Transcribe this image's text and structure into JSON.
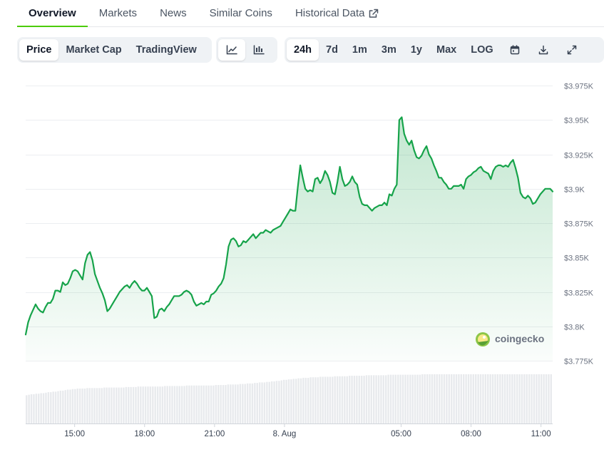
{
  "tabs": [
    {
      "label": "Overview",
      "active": true
    },
    {
      "label": "Markets"
    },
    {
      "label": "News"
    },
    {
      "label": "Similar Coins"
    },
    {
      "label": "Historical Data",
      "external": true
    }
  ],
  "chart_modes": [
    {
      "label": "Price",
      "active": true
    },
    {
      "label": "Market Cap"
    },
    {
      "label": "TradingView"
    }
  ],
  "chart_styles": [
    {
      "icon": "line-chart-icon",
      "active": true
    },
    {
      "icon": "candlestick-icon"
    }
  ],
  "ranges": [
    {
      "label": "24h",
      "active": true
    },
    {
      "label": "7d"
    },
    {
      "label": "1m"
    },
    {
      "label": "3m"
    },
    {
      "label": "1y"
    },
    {
      "label": "Max"
    },
    {
      "label": "LOG"
    }
  ],
  "tools": [
    {
      "icon": "calendar-icon"
    },
    {
      "icon": "download-icon"
    },
    {
      "icon": "fullscreen-icon"
    }
  ],
  "watermark": "coingecko",
  "colors": {
    "line": "#16a34a",
    "accent": "#4bcc00",
    "volume": "#e8eaed",
    "grid": "#eceef1"
  },
  "chart_data": {
    "type": "area",
    "x_labels": [
      "15:00",
      "18:00",
      "21:00",
      "8. Aug",
      "05:00",
      "08:00",
      "11:00"
    ],
    "x_label_hours": [
      15,
      18,
      21,
      24,
      29,
      32,
      35
    ],
    "x_start_hour": 12.9,
    "x_end_hour": 35.5,
    "y_ticks": [
      3775,
      3800,
      3825,
      3850,
      3875,
      3900,
      3925,
      3950,
      3975
    ],
    "y_tick_labels": [
      "$3.775K",
      "$3.8K",
      "$3.825K",
      "$3.85K",
      "$3.875K",
      "$3.9K",
      "$3.925K",
      "$3.95K",
      "$3.975K"
    ],
    "ylim": [
      3775,
      3975
    ],
    "grid": true,
    "series": [
      {
        "values": [
          3794,
          3803,
          3808,
          3812,
          3816,
          3813,
          3811,
          3810,
          3814,
          3817,
          3817,
          3820,
          3826,
          3826,
          3825,
          3832,
          3830,
          3831,
          3835,
          3840,
          3841,
          3840,
          3837,
          3834,
          3846,
          3852,
          3854,
          3848,
          3838,
          3833,
          3828,
          3824,
          3819,
          3811,
          3813,
          3816,
          3819,
          3822,
          3825,
          3827,
          3829,
          3830,
          3828,
          3831,
          3833,
          3831,
          3828,
          3826,
          3826,
          3828,
          3825,
          3822,
          3806,
          3807,
          3812,
          3813,
          3811,
          3814,
          3816,
          3819,
          3822,
          3822,
          3822,
          3823,
          3825,
          3826,
          3825,
          3823,
          3818,
          3815,
          3816,
          3817,
          3816,
          3818,
          3818,
          3823,
          3824,
          3826,
          3829,
          3831,
          3835,
          3845,
          3858,
          3863,
          3864,
          3862,
          3858,
          3859,
          3862,
          3861,
          3863,
          3865,
          3867,
          3864,
          3866,
          3868,
          3868,
          3870,
          3869,
          3868,
          3870,
          3871,
          3872,
          3873,
          3876,
          3879,
          3882,
          3885,
          3884,
          3884,
          3901,
          3917,
          3908,
          3900,
          3898,
          3899,
          3898,
          3907,
          3908,
          3904,
          3907,
          3913,
          3910,
          3905,
          3897,
          3896,
          3905,
          3916,
          3907,
          3902,
          3903,
          3905,
          3909,
          3905,
          3903,
          3894,
          3889,
          3888,
          3888,
          3886,
          3884,
          3886,
          3887,
          3888,
          3888,
          3890,
          3888,
          3896,
          3895,
          3900,
          3903,
          3950,
          3952,
          3940,
          3935,
          3932,
          3935,
          3928,
          3923,
          3922,
          3924,
          3928,
          3931,
          3925,
          3922,
          3917,
          3913,
          3908,
          3908,
          3905,
          3903,
          3900,
          3900,
          3902,
          3902,
          3902,
          3903,
          3900,
          3907,
          3909,
          3910,
          3912,
          3913,
          3915,
          3916,
          3913,
          3912,
          3911,
          3907,
          3913,
          3916,
          3917,
          3917,
          3916,
          3917,
          3916,
          3919,
          3921,
          3915,
          3908,
          3897,
          3894,
          3893,
          3895,
          3893,
          3889,
          3890,
          3893,
          3896,
          3898,
          3900,
          3900,
          3900,
          3898
        ]
      }
    ],
    "volume_relative": [
      0.55,
      0.56,
      0.57,
      0.57,
      0.58,
      0.58,
      0.59,
      0.59,
      0.6,
      0.61,
      0.61,
      0.62,
      0.62,
      0.63,
      0.64,
      0.64,
      0.65,
      0.66,
      0.66,
      0.67,
      0.67,
      0.68,
      0.68,
      0.68,
      0.68,
      0.69,
      0.69,
      0.69,
      0.69,
      0.69,
      0.69,
      0.69,
      0.7,
      0.7,
      0.7,
      0.7,
      0.7,
      0.7,
      0.7,
      0.7,
      0.7,
      0.71,
      0.71,
      0.71,
      0.71,
      0.71,
      0.72,
      0.72,
      0.72,
      0.72,
      0.72,
      0.72,
      0.72,
      0.72,
      0.72,
      0.72,
      0.72,
      0.73,
      0.73,
      0.73,
      0.73,
      0.73,
      0.73,
      0.73,
      0.73,
      0.73,
      0.74,
      0.74,
      0.74,
      0.74,
      0.74,
      0.74,
      0.74,
      0.74,
      0.74,
      0.74,
      0.74,
      0.74,
      0.75,
      0.75,
      0.75,
      0.75,
      0.75,
      0.76,
      0.76,
      0.76,
      0.76,
      0.76,
      0.77,
      0.77,
      0.77,
      0.78,
      0.78,
      0.78,
      0.79,
      0.79,
      0.8,
      0.8,
      0.8,
      0.81,
      0.81,
      0.82,
      0.82,
      0.83,
      0.83,
      0.84,
      0.85,
      0.85,
      0.86,
      0.86,
      0.87,
      0.87,
      0.88,
      0.88,
      0.89,
      0.89,
      0.89,
      0.9,
      0.9,
      0.9,
      0.9,
      0.91,
      0.91,
      0.91,
      0.91,
      0.91,
      0.91,
      0.92,
      0.92,
      0.92,
      0.92,
      0.92,
      0.92,
      0.93,
      0.93,
      0.93,
      0.93,
      0.93,
      0.93,
      0.93,
      0.94,
      0.94,
      0.94,
      0.94,
      0.94,
      0.94,
      0.94,
      0.94,
      0.94,
      0.95,
      0.95,
      0.95,
      0.95,
      0.95,
      0.95,
      0.95,
      0.95,
      0.95,
      0.95,
      0.95,
      0.95,
      0.95,
      0.95,
      0.96,
      0.96,
      0.96,
      0.96,
      0.96,
      0.96,
      0.96,
      0.96,
      0.96,
      0.96,
      0.96,
      0.96,
      0.96,
      0.96,
      0.96,
      0.96,
      0.96,
      0.96,
      0.96,
      0.96,
      0.96,
      0.96,
      0.96,
      0.96,
      0.96,
      0.96,
      0.96,
      0.96,
      0.96,
      0.96,
      0.96,
      0.96,
      0.96,
      0.96,
      0.96,
      0.96,
      0.96,
      0.96,
      0.96,
      0.96,
      0.96,
      0.96,
      0.96,
      0.96,
      0.96,
      0.96,
      0.96,
      0.96,
      0.96,
      0.96,
      0.96,
      0.96,
      0.96,
      0.96
    ]
  }
}
